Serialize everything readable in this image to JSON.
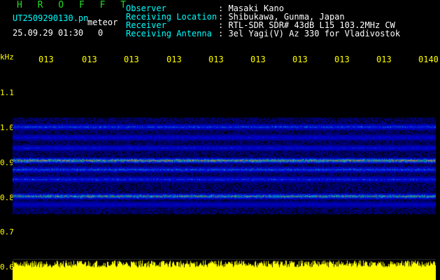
{
  "app": {
    "title": "H R O F F T"
  },
  "file": {
    "name": "UT2509290130.pn",
    "type_label": "meteor",
    "datetime": "25.09.29 01:30",
    "count": "0"
  },
  "info": {
    "rows": [
      {
        "label": "Observer",
        "value": ": Masaki Kano"
      },
      {
        "label": "Receiving Location",
        "value": ": Shibukawa, Gunma, Japan"
      },
      {
        "label": "Receiver",
        "value": ": RTL-SDR SDR# 43dB L15 103.2MHz CW"
      },
      {
        "label": "Receiving Antenna",
        "value": ": 3el Yagi(V) Az 330 for Vladivostok"
      }
    ]
  },
  "axes": {
    "frequency_unit": "kHz",
    "frequency_ticks": [
      "1.1",
      "1.0",
      "0.9",
      "0.8",
      "0.7",
      "0.6"
    ],
    "time_ticks": [
      "013",
      "013",
      "013",
      "013",
      "013",
      "013",
      "013",
      "013",
      "013",
      "0140"
    ]
  },
  "colors": {
    "header_title": "#22dd22",
    "labels": "#00ffff",
    "axis": "#ffff00",
    "background": "#000000"
  }
}
